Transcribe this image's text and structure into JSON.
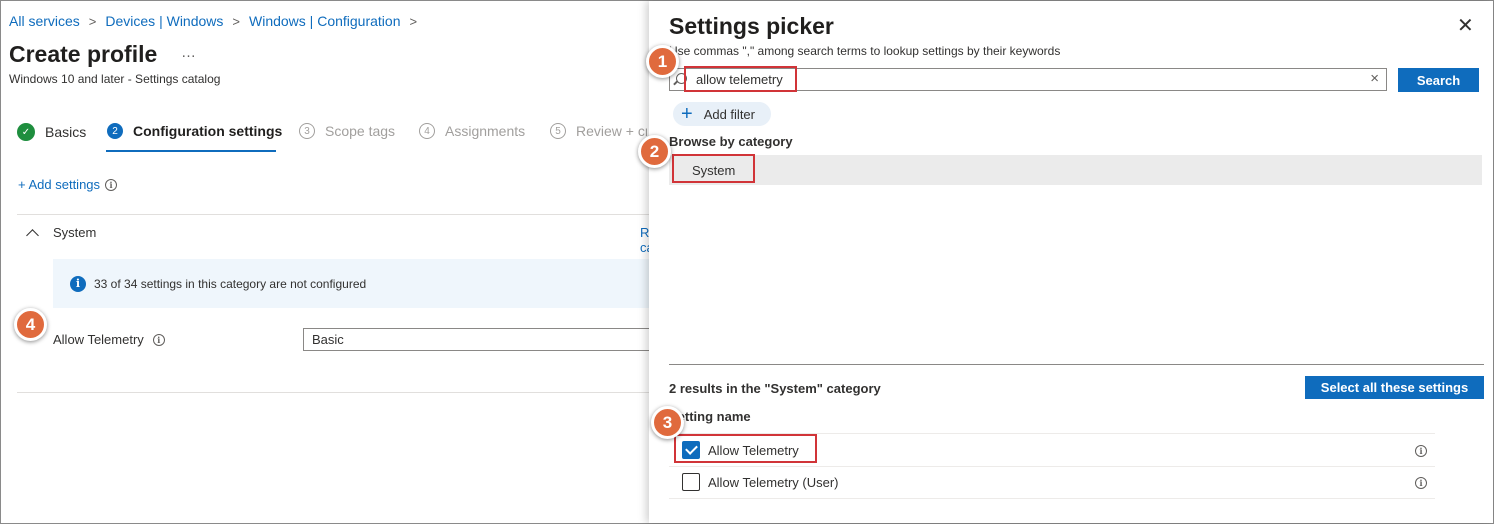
{
  "breadcrumb": {
    "items": [
      "All services",
      "Devices | Windows",
      "Windows | Configuration"
    ]
  },
  "page": {
    "title": "Create profile",
    "more": "…",
    "subtitle": "Windows 10 and later - Settings catalog"
  },
  "steps": [
    {
      "number": "✓",
      "label": "Basics",
      "state": "done"
    },
    {
      "number": "2",
      "label": "Configuration settings",
      "state": "active"
    },
    {
      "number": "3",
      "label": "Scope tags",
      "state": "todo"
    },
    {
      "number": "4",
      "label": "Assignments",
      "state": "todo"
    },
    {
      "number": "5",
      "label": "Review + create",
      "state": "todo"
    }
  ],
  "add_settings": {
    "label": "+ Add settings",
    "info_icon": "i"
  },
  "category_section": {
    "name": "System",
    "remove_label": "Remove category",
    "banner_icon": "i",
    "banner_text": "33 of 34 settings in this category are not configured",
    "setting_label": "Allow Telemetry",
    "setting_info_icon": "i",
    "setting_value": "Basic"
  },
  "picker": {
    "title": "Settings picker",
    "close_icon": "✕",
    "hint": "Use commas \",\" among search terms to lookup settings by their keywords",
    "search_value": "allow telemetry",
    "clear_icon": "×",
    "search_button": "Search",
    "add_filter_plus": "+",
    "add_filter_label": "Add filter",
    "browse_label": "Browse by category",
    "category": "System",
    "results_count": "2 results in the \"System\" category",
    "select_all_button": "Select all these settings",
    "column_header": "Setting name",
    "results": [
      {
        "name": "Allow Telemetry",
        "checked": true,
        "info_icon": "i"
      },
      {
        "name": "Allow Telemetry (User)",
        "checked": false,
        "info_icon": "i"
      }
    ]
  },
  "callouts": [
    "1",
    "2",
    "3",
    "4"
  ],
  "colors": {
    "accent": "#0f6cbd",
    "badge": "#e06a3d",
    "highlight": "#d13438",
    "success": "#1e8e3e"
  }
}
